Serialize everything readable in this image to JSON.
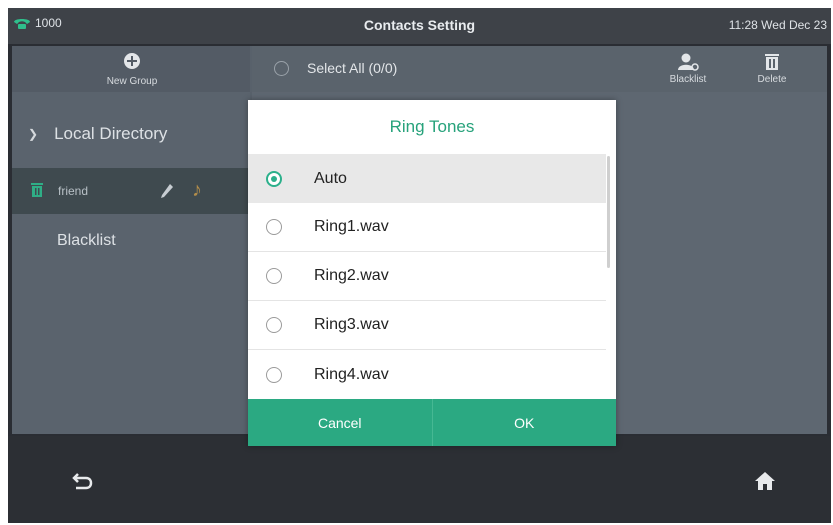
{
  "statusbar": {
    "line": "1000",
    "title": "Contacts Setting",
    "datetime": "11:28 Wed Dec 23"
  },
  "sidebar": {
    "new_group_label": "New Group",
    "local_directory": "Local Directory",
    "friend": "friend",
    "blacklist": "Blacklist"
  },
  "toolbar": {
    "select_all": "Select All (0/0)",
    "blacklist_label": "Blacklist",
    "delete_label": "Delete"
  },
  "dialog": {
    "title": "Ring Tones",
    "options": [
      "Auto",
      "Ring1.wav",
      "Ring2.wav",
      "Ring3.wav",
      "Ring4.wav"
    ],
    "selected_index": 0,
    "cancel_label": "Cancel",
    "ok_label": "OK"
  },
  "colors": {
    "accent": "#2ba982",
    "title_green": "#27a27b",
    "ringtone_note": "#b28d4a"
  },
  "icons": {
    "line": "phone-handset-icon",
    "new_group": "plus-circle-icon",
    "blacklist": "user-block-icon",
    "delete": "trash-icon",
    "back": "back-arrow-icon",
    "home": "home-icon"
  }
}
